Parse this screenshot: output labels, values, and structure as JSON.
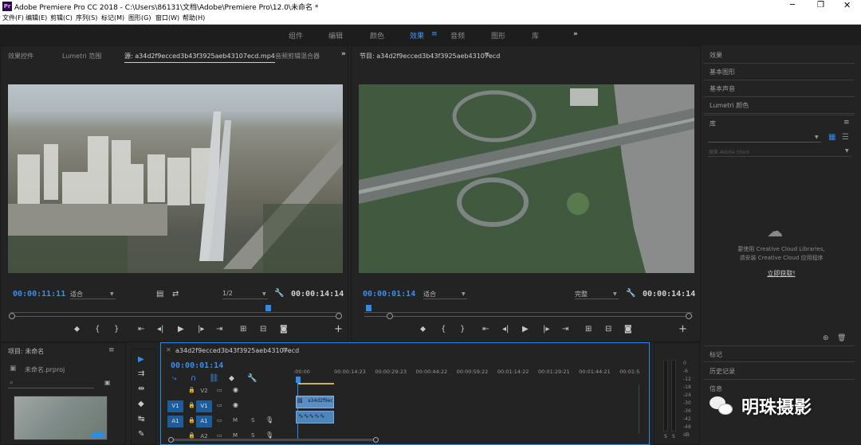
{
  "window": {
    "title": "Adobe Premiere Pro CC 2018 - C:\\Users\\86131\\文档\\Adobe\\Premiere Pro\\12.0\\未命名 *",
    "app_icon": "Pr",
    "controls": [
      "minimize-icon",
      "maximize-icon",
      "close-icon"
    ]
  },
  "menu": [
    "文件(F)",
    "编辑(E)",
    "剪辑(C)",
    "序列(S)",
    "标记(M)",
    "图形(G)",
    "窗口(W)",
    "帮助(H)"
  ],
  "workspaces": [
    "组件",
    "编辑",
    "颜色",
    "效果",
    "音频",
    "图形",
    "库"
  ],
  "workspace_active": "效果",
  "workspace_more": "»",
  "source": {
    "tabs": [
      "效果控件",
      "Lumetri 范围",
      "源: a34d2f9ecced3b43f3925aeb43107ecd.mp4",
      "音频剪辑混合器"
    ],
    "timecode": "00:00:11:11",
    "fit": "适合",
    "resolution": "1/2",
    "duration": "00:00:14:14"
  },
  "program": {
    "tab": "节目: a34d2f9ecced3b43f3925aeb43107ecd",
    "timecode": "00:00:01:14",
    "fit": "适合",
    "quality": "完整",
    "duration": "00:00:14:14"
  },
  "right_panels": [
    "效果",
    "基本图形",
    "基本声音",
    "Lumetri 颜色",
    "库"
  ],
  "library": {
    "search_placeholder": "搜索 Adobe Stock",
    "msg1": "要使用 Creative Cloud Libraries,",
    "msg2": "请安装 Creative Cloud 应用程序",
    "link": "立即获取!"
  },
  "right_bottom": [
    "标记",
    "历史记录",
    "信息"
  ],
  "project": {
    "title": "项目: 未命名",
    "file": "未命名.prproj"
  },
  "timeline": {
    "seq_name": "a34d2f9ecced3b43f3925aeb43107ecd",
    "timecode": "00:00:01:14",
    "ruler": [
      ":00:00",
      "00:00:14:23",
      "00:00:29:23",
      "00:00:44:22",
      "00:00:59:22",
      "00:01:14:22",
      "00:01:29:21",
      "00:01:44:21",
      "00:01:5"
    ],
    "tracks": [
      {
        "src": "",
        "name": "V2"
      },
      {
        "src": "V1",
        "name": "V1"
      },
      {
        "src": "A1",
        "name": "A1"
      },
      {
        "src": "",
        "name": "A2"
      }
    ],
    "clip_label": "a34d2f9ecc"
  },
  "meter": {
    "scale": [
      "0",
      "-6",
      "-12",
      "-18",
      "-24",
      "-30",
      "-36",
      "-42",
      "-48",
      "dB"
    ],
    "solo": [
      "S",
      "S"
    ]
  },
  "watermark": "明珠摄影",
  "colors": {
    "accent": "#2d8ceb",
    "clip_video": "#5b8fc4",
    "clip_audio": "#4d86bb"
  }
}
